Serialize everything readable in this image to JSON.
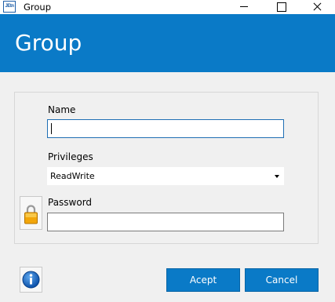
{
  "window": {
    "title": "Group",
    "app_icon_text": "JEtn"
  },
  "header": {
    "title": "Group",
    "background": "#0a7ac7"
  },
  "form": {
    "name": {
      "label": "Name",
      "value": ""
    },
    "privileges": {
      "label": "Privileges",
      "selected": "ReadWrite"
    },
    "password": {
      "label": "Password",
      "value": ""
    }
  },
  "icons": {
    "lock": "lock-icon",
    "info": "info-icon"
  },
  "buttons": {
    "accept": "Acept",
    "cancel": "Cancel"
  }
}
